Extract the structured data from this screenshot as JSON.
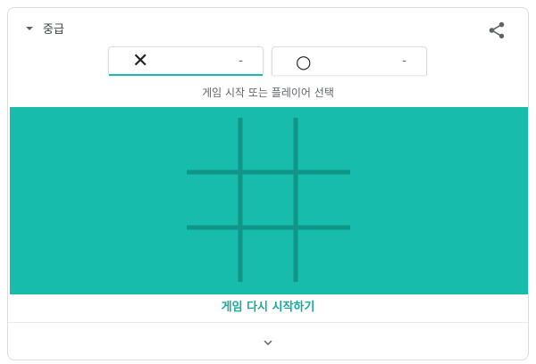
{
  "header": {
    "difficulty_label": "중급",
    "share_icon": "share-icon",
    "caret_icon": "caret-down-icon"
  },
  "players": [
    {
      "mark": "✕",
      "score": "-",
      "active": true
    },
    {
      "mark": "○",
      "score": "-",
      "active": false
    }
  ],
  "status_text": "게임 시작 또는 플레이어 선택",
  "board": {
    "background_color": "#18bcac",
    "grid_color": "#119586",
    "cells": [
      "",
      "",
      "",
      "",
      "",
      "",
      "",
      "",
      ""
    ]
  },
  "restart_label": "게임 다시 시작하기",
  "footer": {
    "expand_icon": "chevron-down-icon"
  },
  "colors": {
    "accent": "#18bcac",
    "restart_text": "#18a89a"
  }
}
